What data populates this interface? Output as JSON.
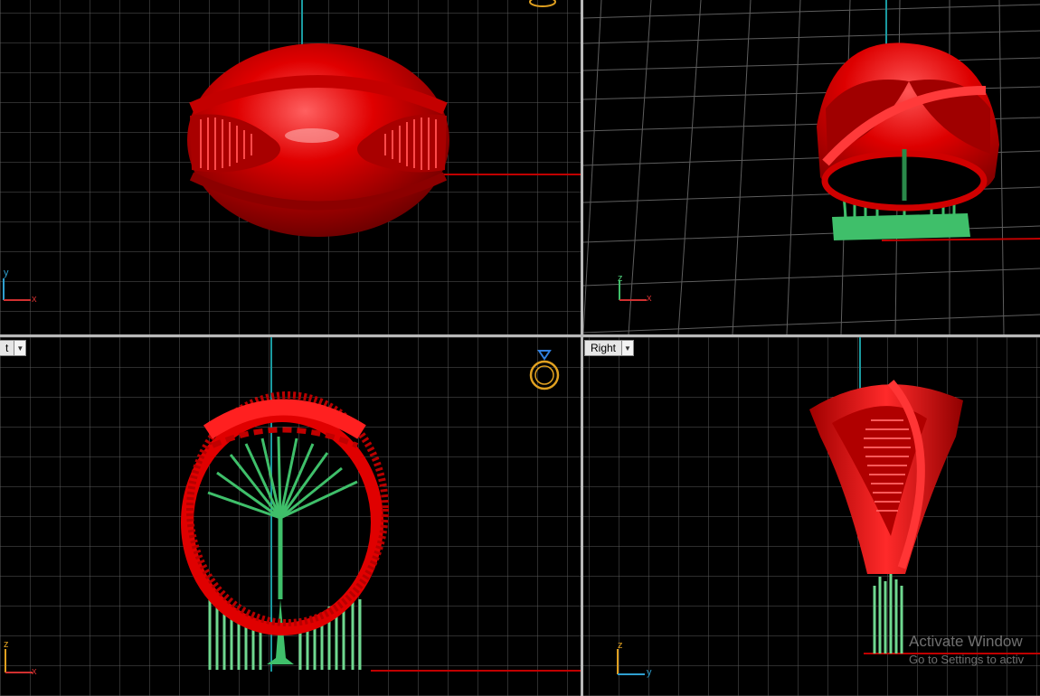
{
  "viewports": {
    "front_label": "t",
    "right_label": "Right"
  },
  "axes": {
    "top_y": "y",
    "top_x": "x",
    "persp_z": "z",
    "persp_x": "x",
    "front_z": "z",
    "front_x": "x",
    "right_z": "z",
    "right_y": "y"
  },
  "watermark": {
    "title": "Activate Window",
    "subtitle": "Go to Settings to activ"
  },
  "colors": {
    "grid": "#5e5e5e",
    "model": "#e00000",
    "supports": "#3fbf6a",
    "x_axis": "#c00000",
    "y_axis": "#1a9aa0"
  },
  "icons": {
    "gumball_top": "ring-gem-icon",
    "gumball_front": "ring-gem-icon"
  }
}
